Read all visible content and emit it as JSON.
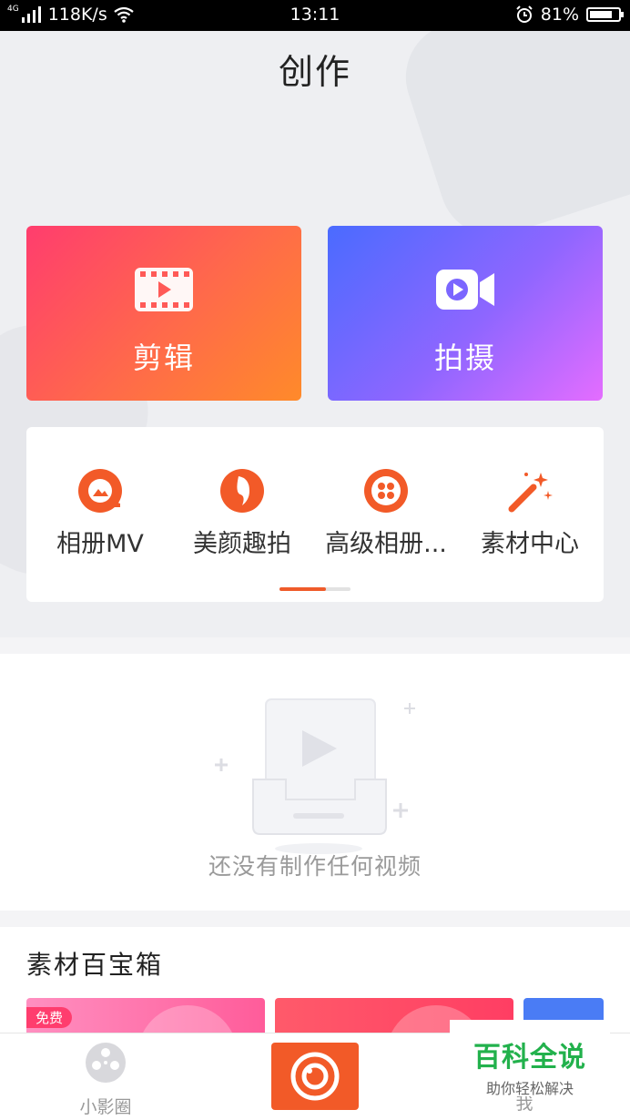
{
  "status_bar": {
    "network_type": "4G",
    "speed": "118K/s",
    "time": "13:11",
    "battery": "81%",
    "battery_level": 0.81
  },
  "header": {
    "title": "创作"
  },
  "main_actions": {
    "edit": {
      "label": "剪辑",
      "icon": "film-icon"
    },
    "shoot": {
      "label": "拍摄",
      "icon": "video-camera-icon"
    }
  },
  "tools": [
    {
      "label": "相册MV",
      "icon": "album-mv-icon"
    },
    {
      "label": "美颜趣拍",
      "icon": "beauty-face-icon"
    },
    {
      "label": "高级相册...",
      "icon": "film-reel-icon"
    },
    {
      "label": "素材中心",
      "icon": "magic-wand-icon"
    }
  ],
  "tools_scroll_position": 0.65,
  "empty_state": {
    "text": "还没有制作任何视频"
  },
  "toolbox": {
    "title": "素材百宝箱",
    "badge": "免费"
  },
  "bottom_nav": {
    "left_label": "小影圈",
    "right_label": "我"
  },
  "watermark": {
    "title": "百科全说",
    "subtitle": "助你轻松解决"
  },
  "colors": {
    "accent": "#f25a28",
    "edit_gradient": [
      "#ff3d6e",
      "#ff8a2a"
    ],
    "shoot_gradient": [
      "#4a6bff",
      "#e46dff"
    ],
    "watermark_green": "#22b14c"
  }
}
